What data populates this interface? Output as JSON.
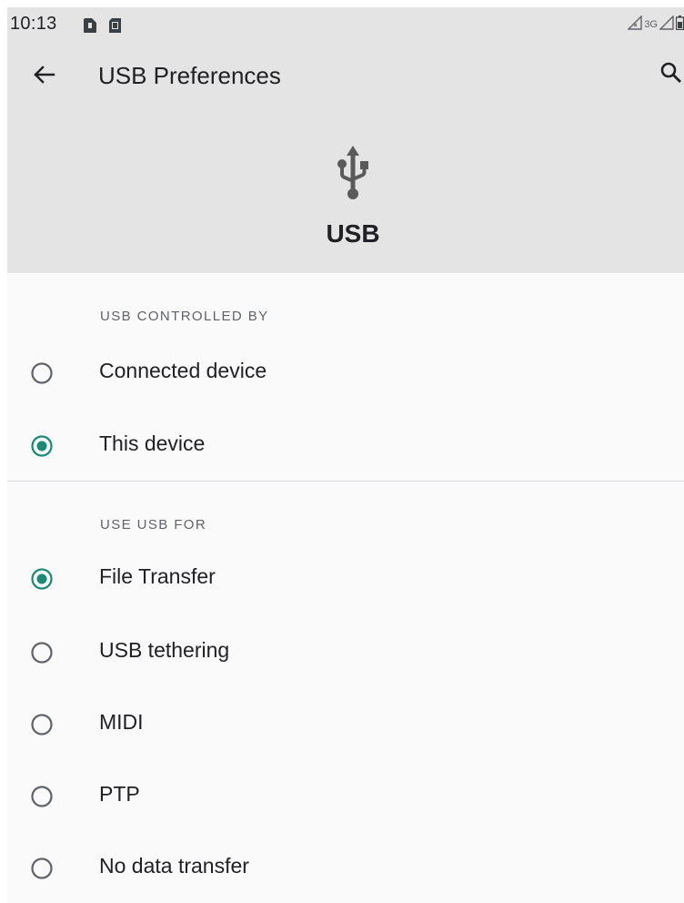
{
  "status_bar": {
    "time": "10:13",
    "network": "3G",
    "icons": [
      "sim-card-icon",
      "sd-card-icon",
      "signal-icon",
      "battery-icon"
    ]
  },
  "app_bar": {
    "title": "USB Preferences",
    "back_icon": "arrow-back-icon",
    "search_icon": "search-icon"
  },
  "header": {
    "icon": "usb-icon",
    "title": "USB"
  },
  "controlled_by": {
    "label": "USB CONTROLLED BY",
    "options": [
      {
        "label": "Connected device",
        "selected": false
      },
      {
        "label": "This device",
        "selected": true
      }
    ]
  },
  "use_for": {
    "label": "USE USB FOR",
    "options": [
      {
        "label": "File Transfer",
        "selected": true
      },
      {
        "label": "USB tethering",
        "selected": false
      },
      {
        "label": "MIDI",
        "selected": false
      },
      {
        "label": "PTP",
        "selected": false
      },
      {
        "label": "No data transfer",
        "selected": false
      }
    ]
  },
  "colors": {
    "accent": "#1a8a76",
    "header_bg": "#e4e4e4",
    "page_bg": "#fafafa",
    "radio_off": "#5f6368"
  }
}
